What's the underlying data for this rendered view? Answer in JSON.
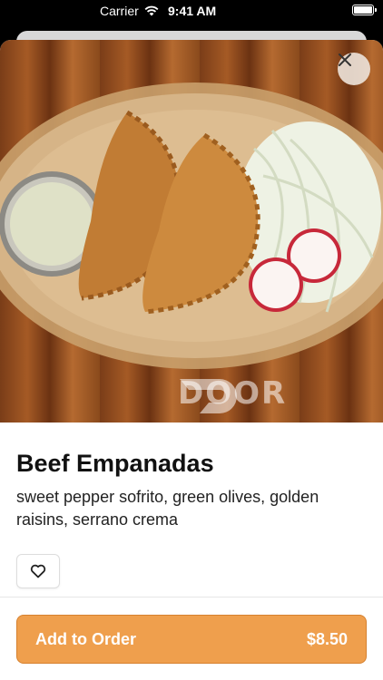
{
  "status_bar": {
    "carrier": "Carrier",
    "time": "9:41 AM"
  },
  "hero": {
    "image_alt": "Beef empanadas on a plate with sauce cup, cabbage and radish",
    "watermark_text": "DOOR"
  },
  "item": {
    "title": "Beef Empanadas",
    "description": "sweet pepper sofrito, green olives, golden raisins, serrano crema"
  },
  "actions": {
    "add_label": "Add to Order",
    "price": "$8.50"
  },
  "colors": {
    "accent": "#ef9f4d",
    "accent_border": "#d6812f"
  },
  "icons": {
    "close": "close-icon",
    "favorite": "heart-icon",
    "wifi": "wifi-icon",
    "battery": "battery-icon"
  }
}
